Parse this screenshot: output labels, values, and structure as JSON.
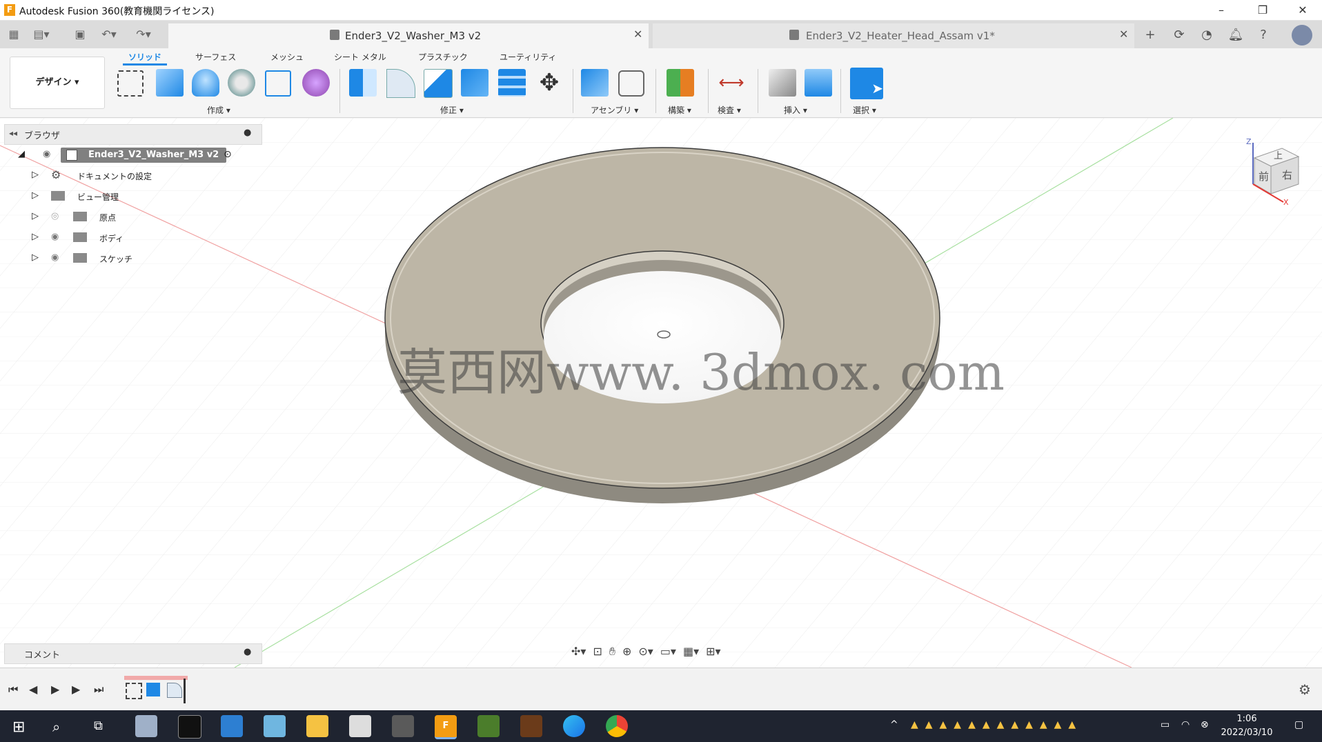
{
  "window": {
    "title": "Autodesk Fusion 360(教育機関ライセンス)",
    "logo": "F"
  },
  "tabs": [
    {
      "label": "Ender3_V2_Washer_M3 v2",
      "active": true
    },
    {
      "label": "Ender3_V2_Heater_Head_Assam v1*",
      "active": false
    }
  ],
  "workspace": {
    "label": "デザイン ▾"
  },
  "ribbon_tabs": [
    "ソリッド",
    "サーフェス",
    "メッシュ",
    "シート メタル",
    "プラスチック",
    "ユーティリティ"
  ],
  "ribbon_groups": [
    "作成 ▾",
    "修正 ▾",
    "アセンブリ ▾",
    "構築 ▾",
    "検査 ▾",
    "挿入 ▾",
    "選択 ▾"
  ],
  "browser": {
    "title": "ブラウザ",
    "root": "Ender3_V2_Washer_M3 v2",
    "items": [
      "ドキュメントの設定",
      "ビュー管理",
      "原点",
      "ボディ",
      "スケッチ"
    ]
  },
  "comments": {
    "title": "コメント"
  },
  "viewcube": {
    "top": "上",
    "front": "前",
    "right": "右",
    "axis_x": "X",
    "axis_z": "Z"
  },
  "watermark": "莫西网www. 3dmox. com",
  "clock": {
    "time": "1:06",
    "date": "2022/03/10"
  },
  "colors": {
    "accent": "#1e88e5",
    "washer": "#bdb6a6",
    "taskbar": "#1f2430"
  }
}
